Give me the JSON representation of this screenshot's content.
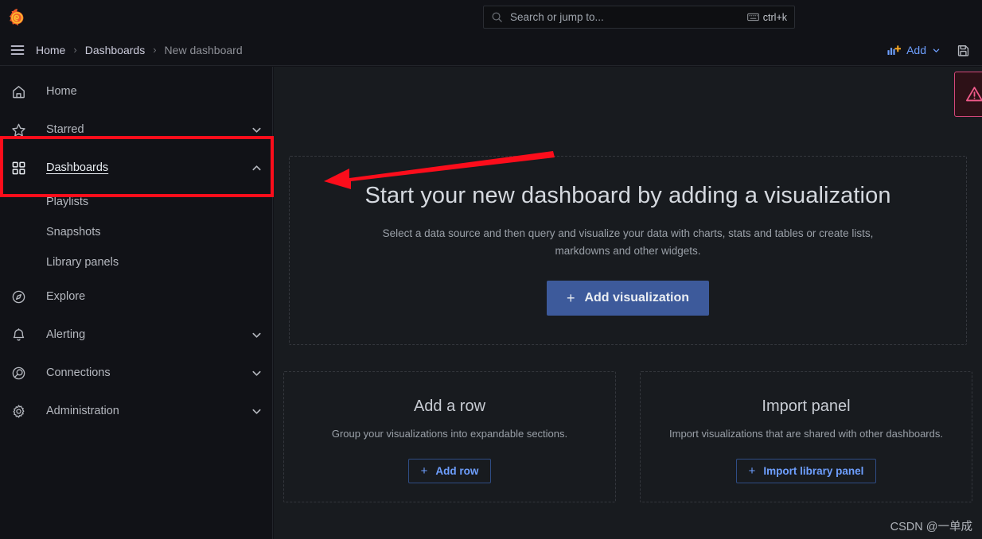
{
  "app": {
    "logo_icon": "grafana-logo-icon",
    "watermark": "CSDN @一单成"
  },
  "search": {
    "icon": "search-icon",
    "placeholder": "Search or jump to...",
    "shortcut": "ctrl+k",
    "shortcut_icon": "keyboard-icon"
  },
  "navbar": {
    "menu_icon": "hamburger-menu-icon",
    "breadcrumb": [
      {
        "label": "Home",
        "current": false
      },
      {
        "label": "Dashboards",
        "current": false
      },
      {
        "label": "New dashboard",
        "current": true
      }
    ],
    "separator": "›",
    "add_label": "Add",
    "add_icon": "add-visualization-icon",
    "add_chevron_icon": "chevron-down-icon",
    "save_icon": "save-disk-icon"
  },
  "sidebar": {
    "items": [
      {
        "label": "Home",
        "icon": "home-icon",
        "expandable": false,
        "active": false,
        "chevron": null
      },
      {
        "label": "Starred",
        "icon": "star-icon",
        "expandable": true,
        "active": false,
        "chevron": "chevron-down-icon"
      },
      {
        "label": "Dashboards",
        "icon": "apps-grid-icon",
        "expandable": true,
        "active": true,
        "chevron": "chevron-up-icon"
      }
    ],
    "dashboard_children": [
      {
        "label": "Playlists"
      },
      {
        "label": "Snapshots"
      },
      {
        "label": "Library panels"
      }
    ],
    "items_lower": [
      {
        "label": "Explore",
        "icon": "compass-icon",
        "expandable": false,
        "chevron": null
      },
      {
        "label": "Alerting",
        "icon": "bell-icon",
        "expandable": true,
        "chevron": "chevron-down-icon"
      },
      {
        "label": "Connections",
        "icon": "connections-icon",
        "expandable": true,
        "chevron": "chevron-down-icon"
      },
      {
        "label": "Administration",
        "icon": "gear-icon",
        "expandable": true,
        "chevron": "chevron-down-icon"
      }
    ]
  },
  "main": {
    "empty_panel": {
      "title": "Start your new dashboard by adding a visualization",
      "subtitle": "Select a data source and then query and visualize your data with charts, stats and tables or create lists, markdowns and other widgets.",
      "button_label": "Add visualization",
      "button_plus": "+"
    },
    "cards": [
      {
        "title": "Add a row",
        "subtitle": "Group your visualizations into expandable sections.",
        "button_label": "Add row",
        "button_plus": "+"
      },
      {
        "title": "Import panel",
        "subtitle": "Import visualizations that are shared with other dashboards.",
        "button_label": "Import library panel",
        "button_plus": "+"
      }
    ]
  },
  "toast": {
    "icon": "warning-triangle-icon",
    "type": "error"
  },
  "colors": {
    "accent_blue": "#6e9fff",
    "primary_button": "#3d5a9b",
    "annotation_red": "#fc0d1b",
    "sidebar_bg": "#111217",
    "content_bg": "#181b1f",
    "toast_border": "#d4477a"
  }
}
